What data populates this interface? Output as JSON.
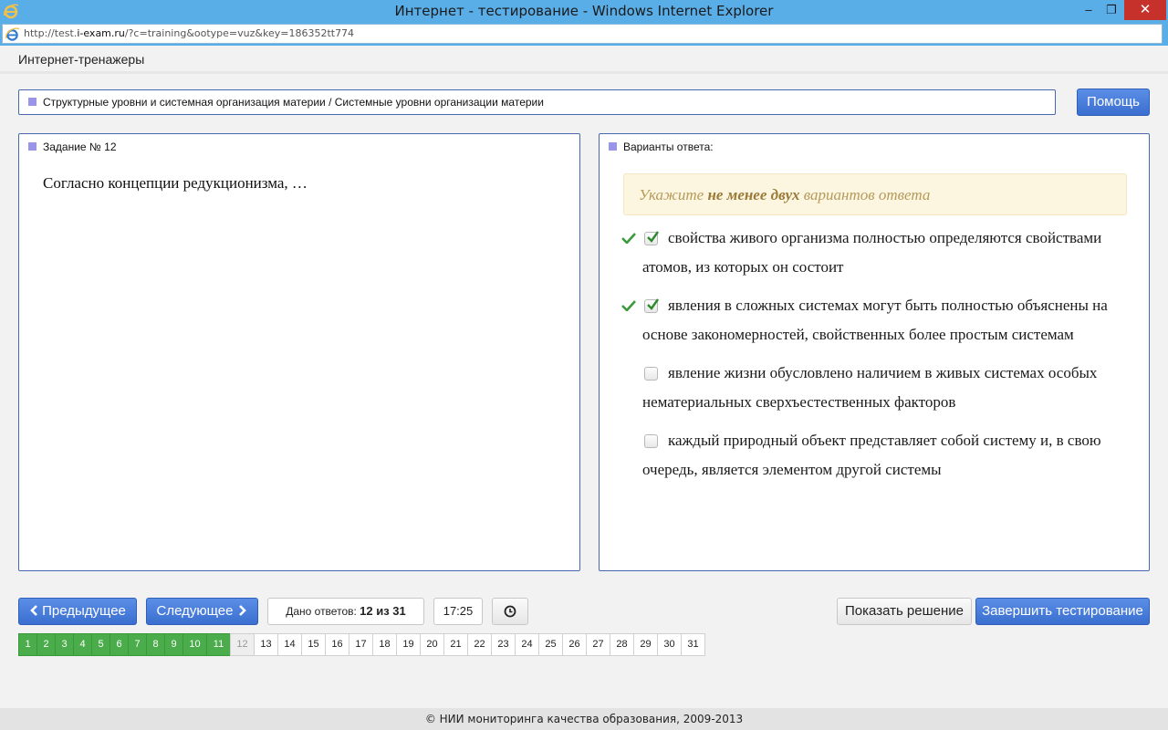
{
  "window": {
    "title": "Интернет - тестирование - Windows Internet Explorer",
    "minimize": "–",
    "maximize": "❐",
    "close": "✕"
  },
  "address": {
    "url_prefix": "http://test.",
    "url_host": "i-exam.ru",
    "url_rest": "/?c=training&ootype=vuz&key=186352tt774"
  },
  "app": {
    "title": "Интернет-тренажеры"
  },
  "topic": {
    "text": "Структурные уровни и системная организация материи / Системные уровни организации материи"
  },
  "help_button": "Помощь",
  "task": {
    "title": "Задание № 12",
    "question": "Согласно концепции редукционизма, …"
  },
  "answers": {
    "title": "Варианты ответа:",
    "hint_pre": "Укажите ",
    "hint_bold": "не менее двух",
    "hint_post": " вариантов ответа",
    "options": [
      {
        "text": "свойства живого организма полностью определяются свойствами атомов, из которых он состоит",
        "checked": true,
        "correct": true
      },
      {
        "text": "явления в сложных системах могут быть полностью объяснены на основе закономерностей, свойственных более простым системам",
        "checked": true,
        "correct": true
      },
      {
        "text": "явление жизни обусловлено наличием в живых системах особых нематериальных сверхъестественных факторов",
        "checked": false,
        "correct": false
      },
      {
        "text": "каждый природный объект представляет собой систему и, в свою очередь, является элементом другой системы",
        "checked": false,
        "correct": false
      }
    ]
  },
  "nav": {
    "prev": "Предыдущее",
    "next": "Следующее",
    "answered_label": "Дано ответов: ",
    "answered_value": "12 из 31",
    "timer": "17:25",
    "show_solution": "Показать решение",
    "finish": "Завершить тестирование"
  },
  "pages": {
    "items": [
      "1",
      "2",
      "3",
      "4",
      "5",
      "6",
      "7",
      "8",
      "9",
      "10",
      "11",
      "12",
      "13",
      "14",
      "15",
      "16",
      "17",
      "18",
      "19",
      "20",
      "21",
      "22",
      "23",
      "24",
      "25",
      "26",
      "27",
      "28",
      "29",
      "30",
      "31"
    ],
    "done_count": 11,
    "current": "12"
  },
  "footer": "© НИИ мониторинга качества образования, 2009-2013",
  "colors": {
    "accent": "#3b6fd0",
    "done": "#4aac4a",
    "hint_bg": "#fcf5e0",
    "marker": "#9b95ea"
  }
}
